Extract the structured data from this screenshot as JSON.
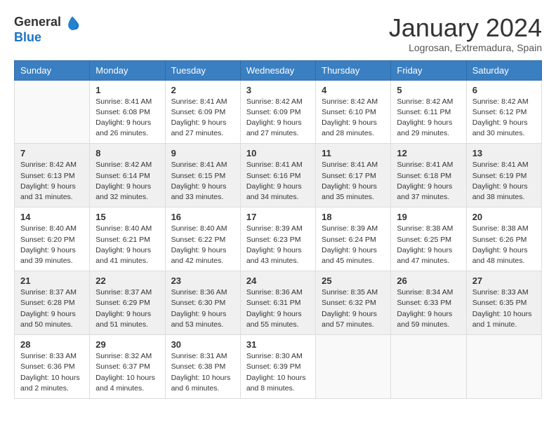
{
  "logo": {
    "general": "General",
    "blue": "Blue"
  },
  "title": "January 2024",
  "subtitle": "Logrosan, Extremadura, Spain",
  "headers": [
    "Sunday",
    "Monday",
    "Tuesday",
    "Wednesday",
    "Thursday",
    "Friday",
    "Saturday"
  ],
  "weeks": [
    [
      {
        "day": "",
        "info": ""
      },
      {
        "day": "1",
        "info": "Sunrise: 8:41 AM\nSunset: 6:08 PM\nDaylight: 9 hours\nand 26 minutes."
      },
      {
        "day": "2",
        "info": "Sunrise: 8:41 AM\nSunset: 6:09 PM\nDaylight: 9 hours\nand 27 minutes."
      },
      {
        "day": "3",
        "info": "Sunrise: 8:42 AM\nSunset: 6:09 PM\nDaylight: 9 hours\nand 27 minutes."
      },
      {
        "day": "4",
        "info": "Sunrise: 8:42 AM\nSunset: 6:10 PM\nDaylight: 9 hours\nand 28 minutes."
      },
      {
        "day": "5",
        "info": "Sunrise: 8:42 AM\nSunset: 6:11 PM\nDaylight: 9 hours\nand 29 minutes."
      },
      {
        "day": "6",
        "info": "Sunrise: 8:42 AM\nSunset: 6:12 PM\nDaylight: 9 hours\nand 30 minutes."
      }
    ],
    [
      {
        "day": "7",
        "info": "Sunrise: 8:42 AM\nSunset: 6:13 PM\nDaylight: 9 hours\nand 31 minutes."
      },
      {
        "day": "8",
        "info": "Sunrise: 8:42 AM\nSunset: 6:14 PM\nDaylight: 9 hours\nand 32 minutes."
      },
      {
        "day": "9",
        "info": "Sunrise: 8:41 AM\nSunset: 6:15 PM\nDaylight: 9 hours\nand 33 minutes."
      },
      {
        "day": "10",
        "info": "Sunrise: 8:41 AM\nSunset: 6:16 PM\nDaylight: 9 hours\nand 34 minutes."
      },
      {
        "day": "11",
        "info": "Sunrise: 8:41 AM\nSunset: 6:17 PM\nDaylight: 9 hours\nand 35 minutes."
      },
      {
        "day": "12",
        "info": "Sunrise: 8:41 AM\nSunset: 6:18 PM\nDaylight: 9 hours\nand 37 minutes."
      },
      {
        "day": "13",
        "info": "Sunrise: 8:41 AM\nSunset: 6:19 PM\nDaylight: 9 hours\nand 38 minutes."
      }
    ],
    [
      {
        "day": "14",
        "info": "Sunrise: 8:40 AM\nSunset: 6:20 PM\nDaylight: 9 hours\nand 39 minutes."
      },
      {
        "day": "15",
        "info": "Sunrise: 8:40 AM\nSunset: 6:21 PM\nDaylight: 9 hours\nand 41 minutes."
      },
      {
        "day": "16",
        "info": "Sunrise: 8:40 AM\nSunset: 6:22 PM\nDaylight: 9 hours\nand 42 minutes."
      },
      {
        "day": "17",
        "info": "Sunrise: 8:39 AM\nSunset: 6:23 PM\nDaylight: 9 hours\nand 43 minutes."
      },
      {
        "day": "18",
        "info": "Sunrise: 8:39 AM\nSunset: 6:24 PM\nDaylight: 9 hours\nand 45 minutes."
      },
      {
        "day": "19",
        "info": "Sunrise: 8:38 AM\nSunset: 6:25 PM\nDaylight: 9 hours\nand 47 minutes."
      },
      {
        "day": "20",
        "info": "Sunrise: 8:38 AM\nSunset: 6:26 PM\nDaylight: 9 hours\nand 48 minutes."
      }
    ],
    [
      {
        "day": "21",
        "info": "Sunrise: 8:37 AM\nSunset: 6:28 PM\nDaylight: 9 hours\nand 50 minutes."
      },
      {
        "day": "22",
        "info": "Sunrise: 8:37 AM\nSunset: 6:29 PM\nDaylight: 9 hours\nand 51 minutes."
      },
      {
        "day": "23",
        "info": "Sunrise: 8:36 AM\nSunset: 6:30 PM\nDaylight: 9 hours\nand 53 minutes."
      },
      {
        "day": "24",
        "info": "Sunrise: 8:36 AM\nSunset: 6:31 PM\nDaylight: 9 hours\nand 55 minutes."
      },
      {
        "day": "25",
        "info": "Sunrise: 8:35 AM\nSunset: 6:32 PM\nDaylight: 9 hours\nand 57 minutes."
      },
      {
        "day": "26",
        "info": "Sunrise: 8:34 AM\nSunset: 6:33 PM\nDaylight: 9 hours\nand 59 minutes."
      },
      {
        "day": "27",
        "info": "Sunrise: 8:33 AM\nSunset: 6:35 PM\nDaylight: 10 hours\nand 1 minute."
      }
    ],
    [
      {
        "day": "28",
        "info": "Sunrise: 8:33 AM\nSunset: 6:36 PM\nDaylight: 10 hours\nand 2 minutes."
      },
      {
        "day": "29",
        "info": "Sunrise: 8:32 AM\nSunset: 6:37 PM\nDaylight: 10 hours\nand 4 minutes."
      },
      {
        "day": "30",
        "info": "Sunrise: 8:31 AM\nSunset: 6:38 PM\nDaylight: 10 hours\nand 6 minutes."
      },
      {
        "day": "31",
        "info": "Sunrise: 8:30 AM\nSunset: 6:39 PM\nDaylight: 10 hours\nand 8 minutes."
      },
      {
        "day": "",
        "info": ""
      },
      {
        "day": "",
        "info": ""
      },
      {
        "day": "",
        "info": ""
      }
    ]
  ]
}
